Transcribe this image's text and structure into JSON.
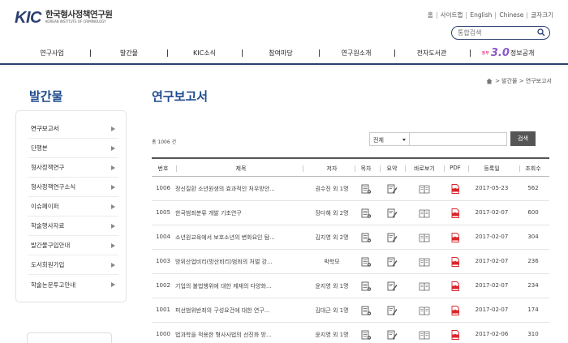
{
  "logo": {
    "mark": "KIC",
    "name_ko": "한국형사정책연구원",
    "name_en": "KOREAN INSTITUTE OF CRIMINOLOGY"
  },
  "util_links": [
    "홈",
    "사이트맵",
    "English",
    "Chinese",
    "글자크기"
  ],
  "search": {
    "placeholder": "통합검색"
  },
  "gnb": [
    {
      "label": "연구사업"
    },
    {
      "label": "발간물"
    },
    {
      "label": "KIC소식"
    },
    {
      "label": "참여마당"
    },
    {
      "label": "연구원소개"
    },
    {
      "label": "전자도서관"
    }
  ],
  "promo": {
    "small": "정부",
    "num": "3.0",
    "label": "정보공개"
  },
  "breadcrumb": "> 발간물 > 연구보고서",
  "section_title": "발간물",
  "page_title": "연구보고서",
  "sidebar": [
    {
      "label": "연구보고서"
    },
    {
      "label": "단행본"
    },
    {
      "label": "형사정책연구"
    },
    {
      "label": "형사정책연구소식"
    },
    {
      "label": "이슈페이퍼"
    },
    {
      "label": "학술행사자료"
    },
    {
      "label": "발간물구입안내"
    },
    {
      "label": "도서회원가입"
    },
    {
      "label": "학술논문투고안내"
    }
  ],
  "count_text": "총 1006 건",
  "filter": {
    "selected": "전체",
    "button": "검색"
  },
  "table": {
    "headers": [
      "번호",
      "제목",
      "저자",
      "목차",
      "요약",
      "바로보기",
      "PDF",
      "등록일",
      "조회수"
    ],
    "rows": [
      {
        "no": "1006",
        "title": "정신질환 소년원생의 효과적인 처우방안...",
        "author": "권수진 외 1명",
        "date": "2017-05-23",
        "views": "562"
      },
      {
        "no": "1005",
        "title": "한국범죄분류 개발 기초연구",
        "author": "장다혜 외 2명",
        "date": "2017-02-07",
        "views": "600"
      },
      {
        "no": "1004",
        "title": "소년원교육에서 보호소년의 변화요인 탐...",
        "author": "김지영 외 2명",
        "date": "2017-02-07",
        "views": "304"
      },
      {
        "no": "1003",
        "title": "방위산업비리(방산비리)범죄의 처벌 강...",
        "author": "박학모",
        "date": "2017-02-07",
        "views": "236"
      },
      {
        "no": "1002",
        "title": "기업의 불법행위에 대한 제재의 다양화...",
        "author": "윤지영 외 1명",
        "date": "2017-02-07",
        "views": "234"
      },
      {
        "no": "1001",
        "title": "피선범위반죄의 구성요건에 대한 연구...",
        "author": "김대근 외 1명",
        "date": "2017-02-07",
        "views": "174"
      },
      {
        "no": "1000",
        "title": "법과학을 적용한 형사사법의 선진화 방...",
        "author": "윤지영 외 1명",
        "date": "2017-02-06",
        "views": "310"
      }
    ]
  },
  "colors": {
    "brand": "#2b3f6f",
    "title": "#1e4a8e",
    "pdf": "#d9262c"
  }
}
